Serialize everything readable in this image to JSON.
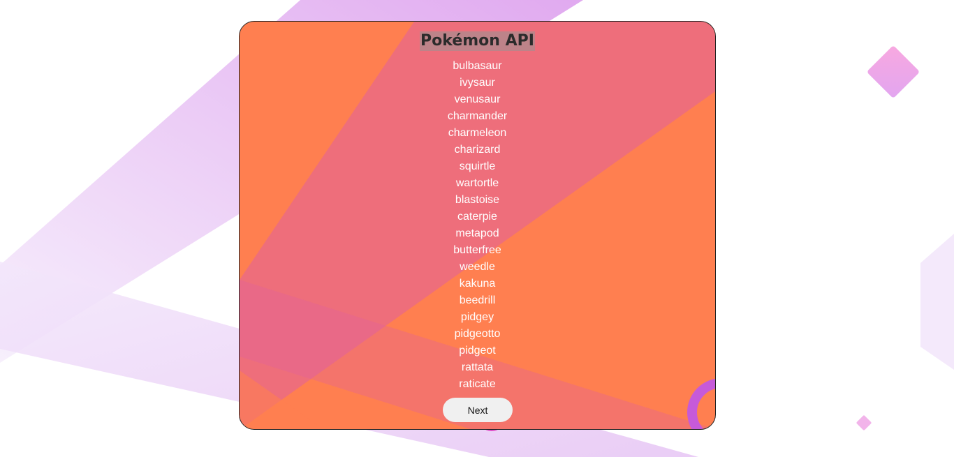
{
  "app": {
    "title": "Pokémon API"
  },
  "pokemon_list": [
    "bulbasaur",
    "ivysaur",
    "venusaur",
    "charmander",
    "charmeleon",
    "charizard",
    "squirtle",
    "wartortle",
    "blastoise",
    "caterpie",
    "metapod",
    "butterfree",
    "weedle",
    "kakuna",
    "beedrill",
    "pidgey",
    "pidgeotto",
    "pidgeot",
    "rattata",
    "raticate"
  ],
  "pagination": {
    "next_label": "Next"
  },
  "colors": {
    "card_background": "#ff7f50",
    "card_overlay": "#e0609f",
    "page_shape_purple": "#d9a7ee",
    "button_background": "#f0f0f0"
  }
}
